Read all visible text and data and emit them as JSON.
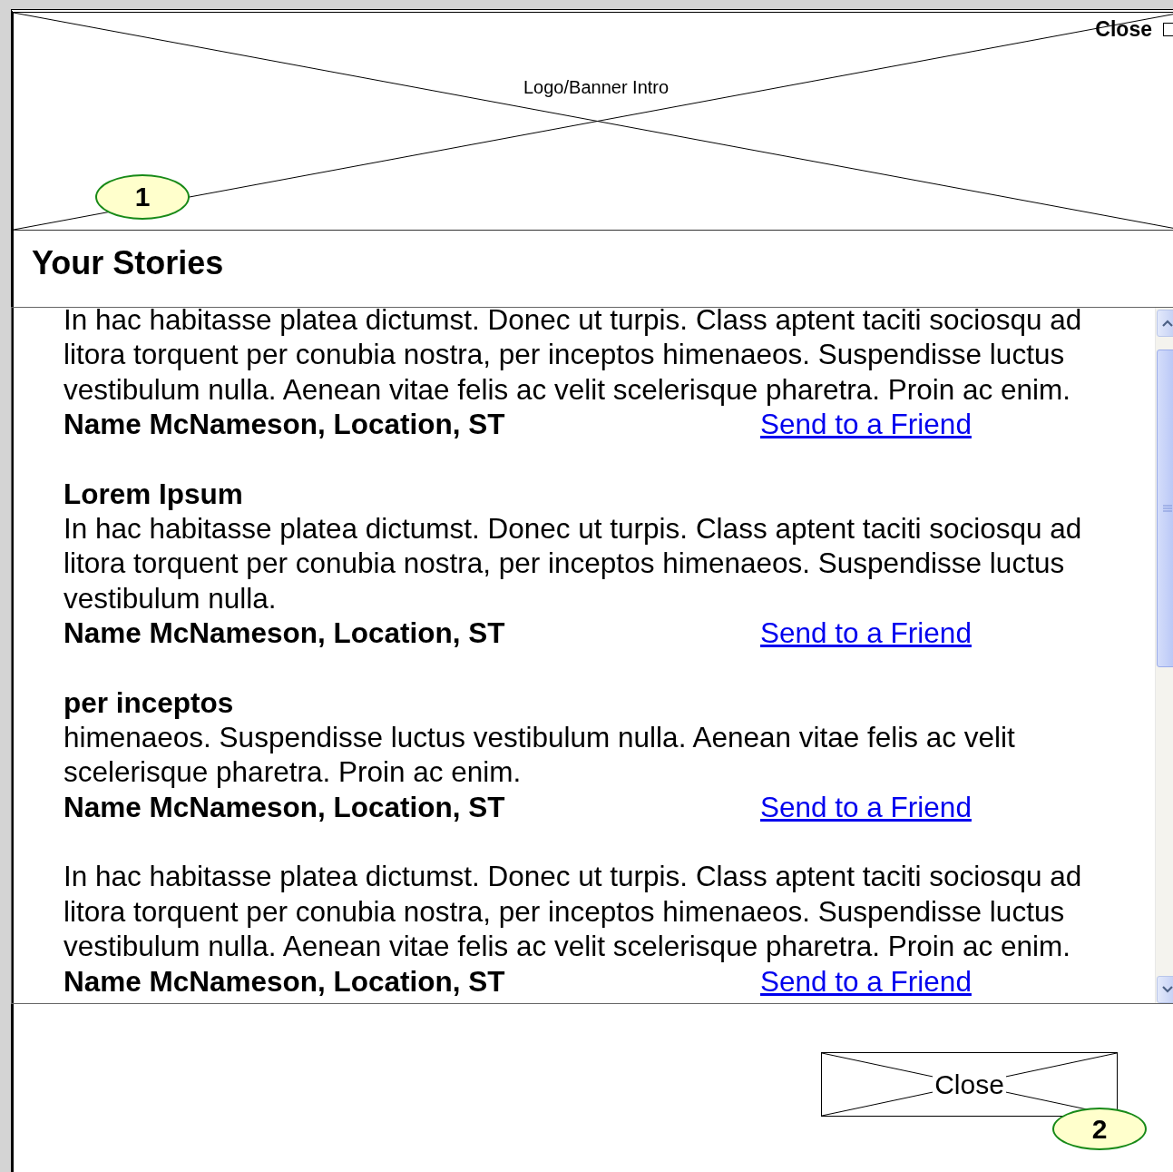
{
  "banner": {
    "label": "Logo/Banner Intro",
    "callout": "1"
  },
  "close_link": {
    "label": "Close"
  },
  "heading": "Your Stories",
  "stories": [
    {
      "body": "In hac habitasse platea dictumst. Donec ut turpis. Class aptent taciti sociosqu ad litora torquent per conubia nostra, per inceptos himenaeos. Suspendisse luctus vestibulum nulla. Aenean vitae felis ac velit scelerisque pharetra. Proin ac enim.",
      "author": "Name McNameson, Location, ST",
      "link": "Send to a Friend"
    },
    {
      "title": "Lorem Ipsum",
      "body": "In hac habitasse platea dictumst. Donec ut turpis. Class aptent taciti sociosqu ad litora torquent per conubia nostra, per inceptos himenaeos. Suspendisse luctus vestibulum nulla.",
      "author": "Name McNameson, Location, ST",
      "link": "Send to a Friend"
    },
    {
      "title": "per inceptos",
      "body": "himenaeos. Suspendisse luctus vestibulum nulla. Aenean vitae felis ac velit scelerisque pharetra. Proin ac enim.",
      "author": "Name McNameson, Location, ST",
      "link": "Send to a Friend"
    },
    {
      "body": "In hac habitasse platea dictumst. Donec ut turpis. Class aptent taciti sociosqu ad litora torquent per conubia nostra, per inceptos himenaeos. Suspendisse luctus vestibulum nulla. Aenean vitae felis ac velit scelerisque pharetra. Proin ac enim.",
      "author": "Name McNameson, Location, ST",
      "link": "Send to a Friend"
    }
  ],
  "close_button": {
    "label": "Close",
    "callout": "2"
  }
}
